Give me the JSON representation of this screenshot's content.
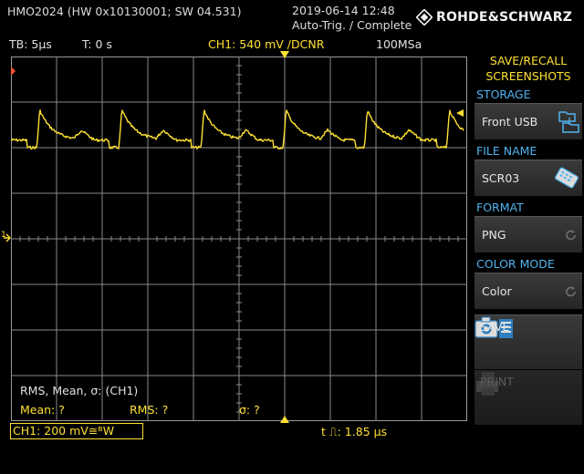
{
  "header": {
    "model": "HMO2024 (HW 0x10130001; SW 04.531)",
    "datetime": "2019-06-14 12:48",
    "trigger_status": "Auto-Trig. / Complete",
    "brand": "ROHDE&SCHWARZ"
  },
  "status": {
    "timebase": "TB: 5µs",
    "trigger_time": "T: 0 s",
    "ch1_trigger": "CH1: 540 mV ∕DCNR",
    "sample_rate": "100MSa"
  },
  "screen": {
    "trigger_marker": "↓",
    "ch1_marker": "1"
  },
  "measurements": {
    "title": "RMS, Mean, σ: (CH1)",
    "mean": "Mean: ?",
    "rms": "RMS: ?",
    "sigma": "σ: ?"
  },
  "bottom": {
    "ch1_scale": "CH1: 200 mV≅ᴮW",
    "pulse": "t ⎍: 1.85 µs"
  },
  "panel": {
    "title_line1": "SAVE/RECALL",
    "title_line2": "SCREENSHOTS",
    "storage_label": "STORAGE",
    "storage_value": "Front USB",
    "filename_label": "FILE NAME",
    "filename_value": "SCR03",
    "format_label": "FORMAT",
    "format_value": "PNG",
    "colormode_label": "COLOR MODE",
    "colormode_value": "Color",
    "save_label": "SAVE",
    "print_label": "PRINT"
  },
  "colors": {
    "trace": "#ffe033",
    "panel_label": "#4fb3f0",
    "grid": "#8a8a8a"
  },
  "icons": {
    "storage": "usb-folder-icon",
    "filename": "keyboard-icon",
    "format": "rotate-icon",
    "colormode": "rotate-icon",
    "save": "camera-icon",
    "print": "printer-icon"
  }
}
